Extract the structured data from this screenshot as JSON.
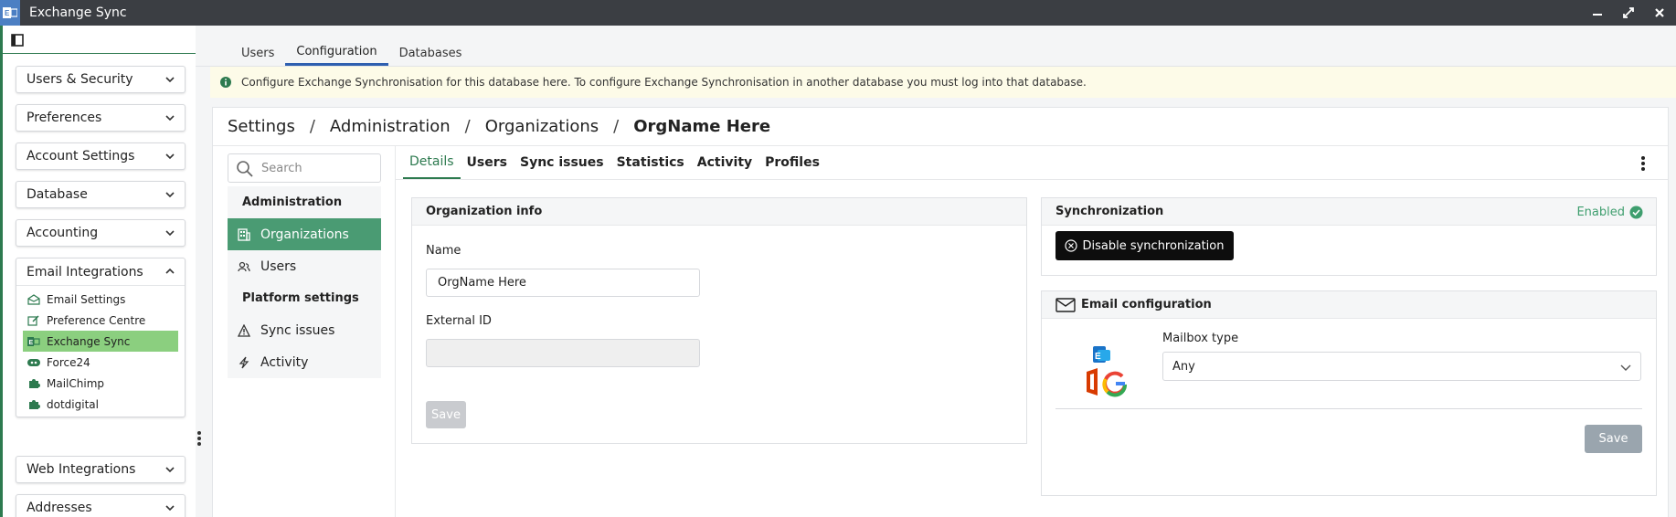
{
  "window": {
    "title": "Exchange Sync",
    "icon": "exchange-icon",
    "accent": "#4c7fc3"
  },
  "sidebar": {
    "groups": [
      {
        "label": "Users & Security"
      },
      {
        "label": "Preferences"
      },
      {
        "label": "Account Settings"
      },
      {
        "label": "Database"
      },
      {
        "label": "Accounting"
      }
    ],
    "email_integrations": {
      "label": "Email Integrations",
      "items": [
        {
          "label": "Email Settings",
          "icon": "envelope-open-icon"
        },
        {
          "label": "Preference Centre",
          "icon": "edit-icon"
        },
        {
          "label": "Exchange Sync",
          "icon": "exchange-icon",
          "active": true
        },
        {
          "label": "Force24",
          "icon": "force24-icon"
        },
        {
          "label": "MailChimp",
          "icon": "puzzle-icon"
        },
        {
          "label": "dotdigital",
          "icon": "puzzle-icon"
        }
      ]
    },
    "groups_after": [
      {
        "label": "Web Integrations"
      },
      {
        "label": "Addresses"
      }
    ]
  },
  "top_tabs": [
    {
      "label": "Users"
    },
    {
      "label": "Configuration",
      "active": true
    },
    {
      "label": "Databases"
    }
  ],
  "banner": {
    "text": "Configure Exchange Synchronisation for this database here. To configure Exchange Synchronisation in another database you must log into that database."
  },
  "breadcrumb": {
    "parts": [
      "Settings",
      "Administration",
      "Organizations"
    ],
    "current": "OrgName Here"
  },
  "side_nav": {
    "search_placeholder": "Search",
    "sections": [
      {
        "heading": "Administration",
        "items": [
          {
            "label": "Organizations",
            "icon": "building-icon",
            "active": true
          },
          {
            "label": "Users",
            "icon": "users-icon"
          }
        ]
      },
      {
        "heading": "Platform settings",
        "items": [
          {
            "label": "Sync issues",
            "icon": "warning-icon"
          },
          {
            "label": "Activity",
            "icon": "activity-icon"
          }
        ]
      }
    ]
  },
  "content_tabs": [
    {
      "label": "Details",
      "active": true
    },
    {
      "label": "Users"
    },
    {
      "label": "Sync issues"
    },
    {
      "label": "Statistics"
    },
    {
      "label": "Activity"
    },
    {
      "label": "Profiles"
    }
  ],
  "org_info": {
    "title": "Organization info",
    "name_label": "Name",
    "name_value": "OrgName Here",
    "external_id_label": "External ID",
    "external_id_value": "",
    "save_label": "Save"
  },
  "synchronization": {
    "title": "Synchronization",
    "status": "Enabled",
    "status_color": "#3e9e6e",
    "disable_label": "Disable synchronization"
  },
  "email_config": {
    "title": "Email configuration",
    "mailbox_type_label": "Mailbox type",
    "mailbox_type_value": "Any",
    "save_label": "Save"
  },
  "colors": {
    "primary_green": "#2d7a4f",
    "active_nav": "#4a9b73",
    "active_sub": "#8bcf7f",
    "tab_underline": "#2e5fb0"
  }
}
